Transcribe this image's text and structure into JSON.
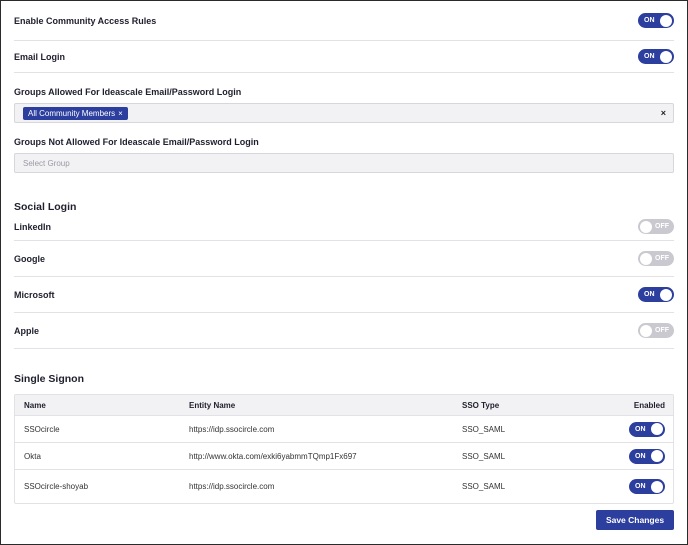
{
  "access": {
    "enable_community_label": "Enable Community Access Rules",
    "enable_community_state": "ON",
    "email_login_label": "Email Login",
    "email_login_state": "ON"
  },
  "groups_allowed": {
    "label": "Groups Allowed For Ideascale Email/Password Login",
    "chips": [
      "All Community Members"
    ],
    "chip_remove": "×",
    "clear": "×"
  },
  "groups_not_allowed": {
    "label": "Groups Not Allowed For Ideascale Email/Password Login",
    "placeholder": "Select Group"
  },
  "social_login": {
    "title": "Social Login",
    "items": [
      {
        "label": "LinkedIn",
        "state": "OFF"
      },
      {
        "label": "Google",
        "state": "OFF"
      },
      {
        "label": "Microsoft",
        "state": "ON"
      },
      {
        "label": "Apple",
        "state": "OFF"
      }
    ]
  },
  "single_signon": {
    "title": "Single Signon",
    "columns": [
      "Name",
      "Entity Name",
      "SSO Type",
      "Enabled"
    ],
    "rows": [
      {
        "name": "SSOcircle",
        "entity": "https://idp.ssocircle.com",
        "type": "SSO_SAML",
        "enabled": "ON"
      },
      {
        "name": "Okta",
        "entity": "http://www.okta.com/exki6yabmmTQmp1Fx697",
        "type": "SSO_SAML",
        "enabled": "ON"
      },
      {
        "name": "SSOcircle-shoyab",
        "entity": "https://idp.ssocircle.com",
        "type": "SSO_SAML",
        "enabled": "ON"
      }
    ]
  },
  "actions": {
    "save_label": "Save Changes"
  },
  "colors": {
    "accent": "#2c3e9e",
    "toggle_off": "#c9c9cf"
  }
}
